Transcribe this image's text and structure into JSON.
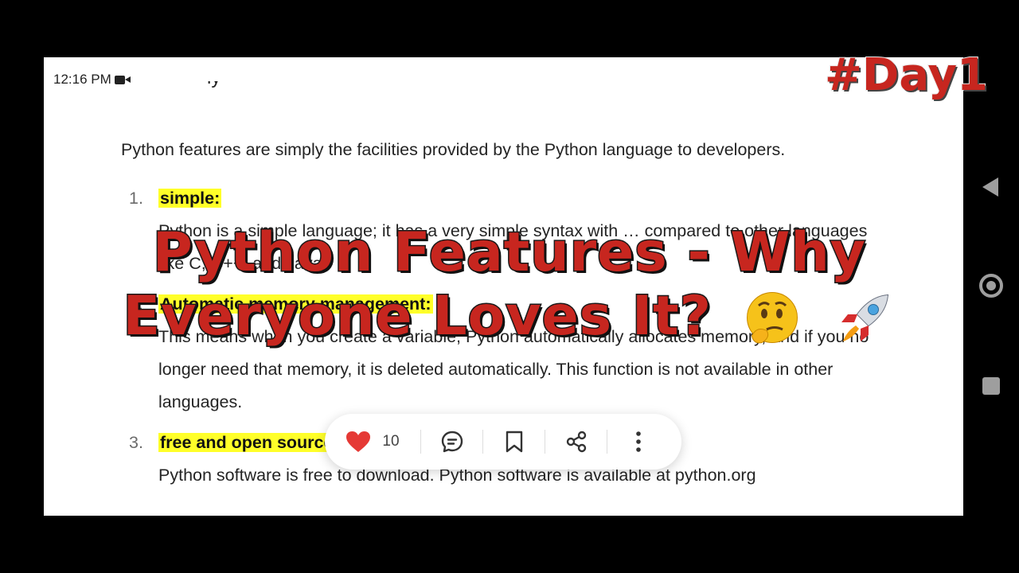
{
  "status_bar": {
    "time": "12:16 PM"
  },
  "article": {
    "intro": "Python features are simply the facilities provided by the Python language to developers.",
    "items": [
      {
        "number": "1.",
        "title": "simple:",
        "desc": "Python is a simple language; it has a very simple syntax with … compared to other languages like C, C++, and Java."
      },
      {
        "number": "2.",
        "title": "Automatic memory management:",
        "desc": "This means when you create a variable, Python automatically allocates memory, and if you no longer need that memory, it is deleted automatically. This function is not available in other languages."
      },
      {
        "number": "3.",
        "title": "free and open source:",
        "desc": "Python software is free to download. Python software is available at python.org"
      }
    ]
  },
  "overlay": {
    "title_line1": "Python Features - Why",
    "title_line2": "Everyone Loves It?",
    "badge": "#Day1"
  },
  "action_bar": {
    "like_count": "10"
  },
  "colors": {
    "highlight": "#ffff29",
    "overlay_red": "#c7261f",
    "like_red": "#e53935"
  }
}
